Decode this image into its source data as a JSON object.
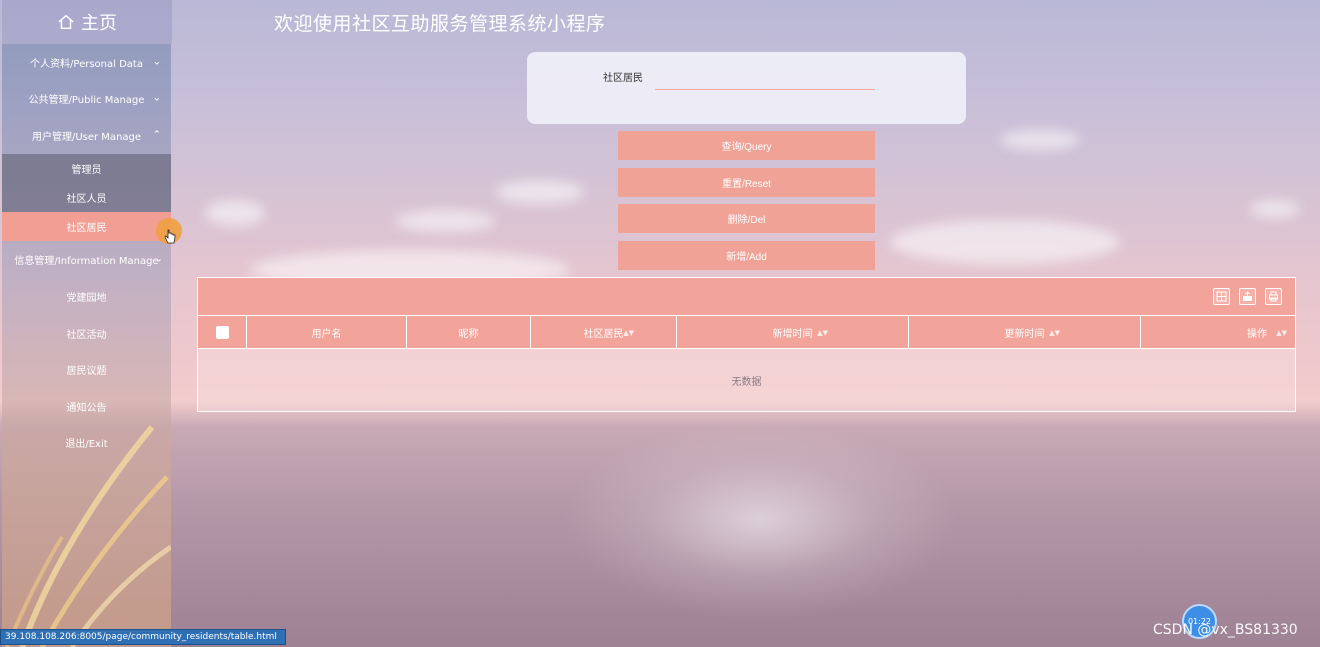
{
  "header": {
    "home_label": "主页",
    "title": "欢迎使用社区互助服务管理系统小程序"
  },
  "sidebar": {
    "groups": [
      {
        "label": "个人资料/Personal Data"
      },
      {
        "label": "公共管理/Public Manage"
      },
      {
        "label": "用户管理/User Manage"
      }
    ],
    "sub_items": [
      {
        "label": "管理员"
      },
      {
        "label": "社区人员"
      },
      {
        "label": "社区居民"
      }
    ],
    "info_group": {
      "label": "信息管理/Information Manage"
    },
    "items": [
      {
        "label": "党建园地"
      },
      {
        "label": "社区活动"
      },
      {
        "label": "居民议题"
      },
      {
        "label": "通知公告"
      },
      {
        "label": "退出/Exit"
      }
    ]
  },
  "search": {
    "label": "社区居民",
    "value": ""
  },
  "buttons": {
    "query": "查询/Query",
    "reset": "重置/Reset",
    "del": "删除/Del",
    "add": "新增/Add"
  },
  "table": {
    "columns": [
      "用户名",
      "昵称",
      "社区居民",
      "新增时间",
      "更新时间",
      "操作"
    ],
    "empty_text": "无数据"
  },
  "status": {
    "url": "39.108.108.206:8005/page/community_residents/table.html",
    "timer": "01:22",
    "watermark": "CSDN @vx_BS81330"
  },
  "colors": {
    "accent": "#f1a297",
    "status_bar": "#2f6fb3"
  }
}
